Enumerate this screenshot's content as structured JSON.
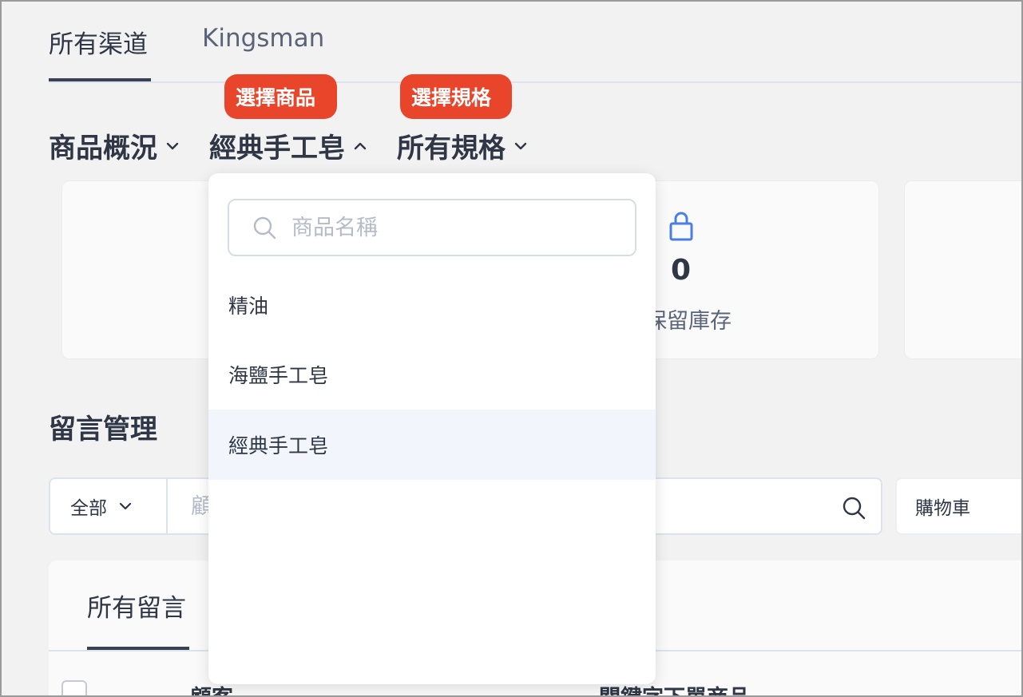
{
  "channel_tabs": [
    {
      "label": "所有渠道",
      "active": true
    },
    {
      "label": "Kingsman",
      "active": false
    }
  ],
  "badges": {
    "select_product": "選擇商品",
    "select_spec": "選擇規格"
  },
  "selectors": {
    "overview": "商品概況",
    "product": "經典手工皂",
    "spec": "所有規格"
  },
  "stats": {
    "reserved_value": "0",
    "reserved_label": "保留庫存"
  },
  "comments": {
    "title": "留言管理",
    "filter_select": "全部",
    "filter_placeholder": "顧客",
    "cart_select": "購物車",
    "list_tab": "所有留言",
    "columns": [
      "顧客",
      "關鍵字下單商品"
    ]
  },
  "dropdown": {
    "search_placeholder": "商品名稱",
    "items": [
      {
        "label": "精油",
        "selected": false
      },
      {
        "label": "海鹽手工皂",
        "selected": false
      },
      {
        "label": "經典手工皂",
        "selected": true
      }
    ]
  },
  "colors": {
    "badge": "#e8452a",
    "lock_icon": "#4a7fe0",
    "selected_row": "#f2f6fc"
  }
}
